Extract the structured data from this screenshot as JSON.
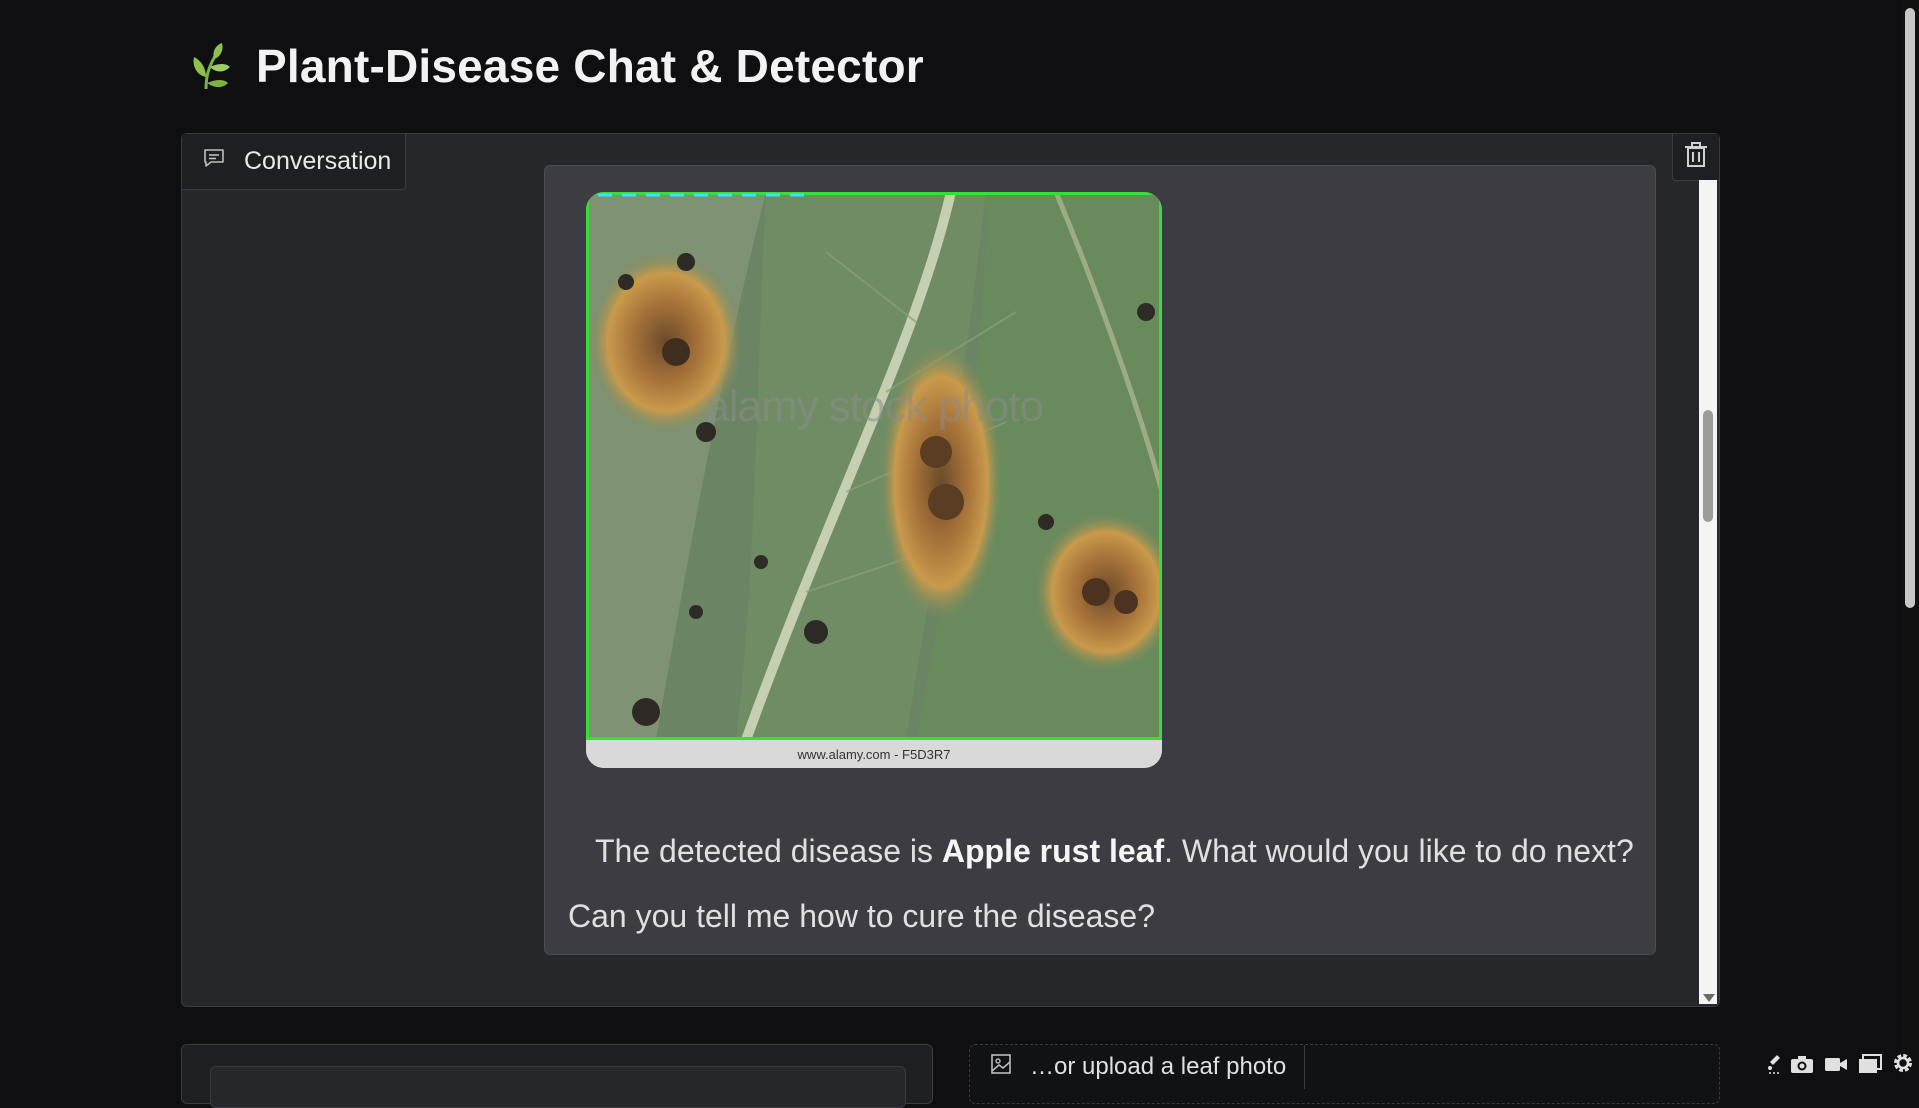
{
  "header": {
    "title": "Plant-Disease Chat & Detector",
    "logo_icon": "leaf-sprout-icon"
  },
  "chatbot": {
    "label": "Conversation",
    "label_icon": "chat-icon",
    "clear_icon": "trash-icon",
    "image_watermark": "alamy stock photo",
    "image_credit": "www.alamy.com - F5D3R7",
    "bot_message_prefix": "The detected disease is ",
    "bot_message_disease": "Apple rust leaf",
    "bot_message_suffix": ". What would you like to do next?",
    "user_message": "Can you tell me how to cure the disease?"
  },
  "upload": {
    "label": "…or upload a leaf photo",
    "icon": "image-icon"
  },
  "toolbar_icons": [
    "brush-icon",
    "camera-icon",
    "video-icon",
    "window-icon",
    "gear-icon"
  ],
  "colors": {
    "background": "#0f0f11",
    "panel": "#26272a",
    "bubble": "#3c3c42",
    "detection_box": "#33e033",
    "logo_green": "#8bc34a"
  }
}
